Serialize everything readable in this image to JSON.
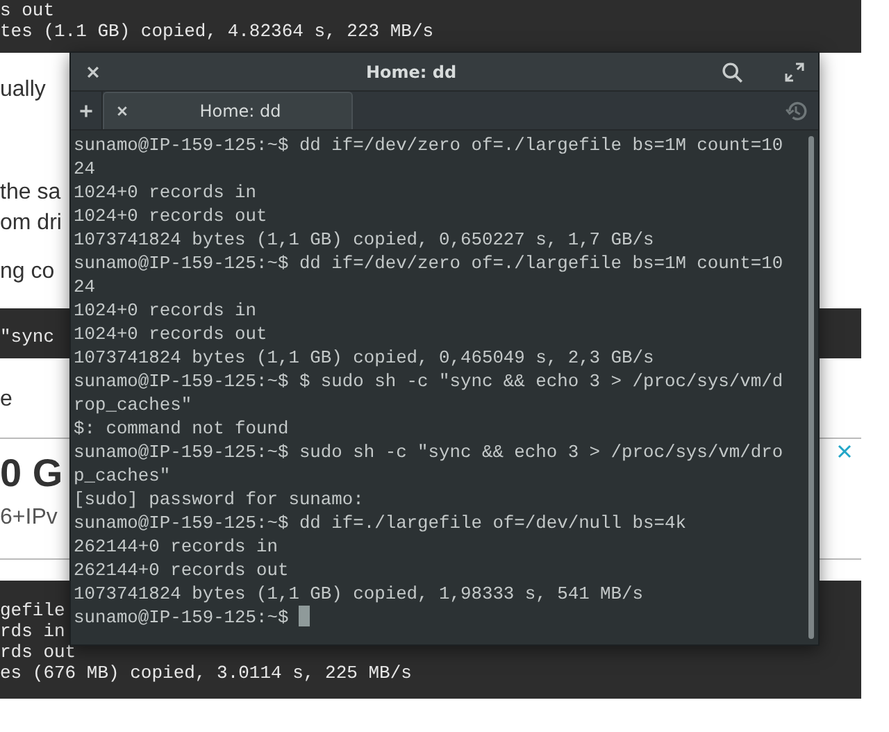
{
  "page": {
    "top_code": [
      "s out",
      "tes (1.1 GB) copied, 4.82364 s, 223 MB/s"
    ],
    "paragraph_fragments": [
      "ually",
      "the sa",
      "om dri",
      "ng co"
    ],
    "mid_code": [
      "\"sync"
    ],
    "fragment_after": "e",
    "ad": {
      "headline": "0 G",
      "subline": "6+IPv"
    },
    "bottom_code": [
      "gefile",
      "rds in",
      "rds out",
      "es (676 MB) copied, 3.0114 s, 225 MB/s"
    ]
  },
  "terminal": {
    "title": "Home: dd",
    "tabs": [
      {
        "label": "Home: dd",
        "selected": true
      }
    ],
    "lines": [
      "sunamo@IP-159-125:~$ dd if=/dev/zero of=./largefile bs=1M count=10",
      "24",
      "1024+0 records in",
      "1024+0 records out",
      "1073741824 bytes (1,1 GB) copied, 0,650227 s, 1,7 GB/s",
      "sunamo@IP-159-125:~$ dd if=/dev/zero of=./largefile bs=1M count=10",
      "24",
      "1024+0 records in",
      "1024+0 records out",
      "1073741824 bytes (1,1 GB) copied, 0,465049 s, 2,3 GB/s",
      "sunamo@IP-159-125:~$ $ sudo sh -c \"sync && echo 3 > /proc/sys/vm/d",
      "rop_caches\"",
      "$: command not found",
      "sunamo@IP-159-125:~$ sudo sh -c \"sync && echo 3 > /proc/sys/vm/dro",
      "p_caches\"",
      "[sudo] password for sunamo:",
      "sunamo@IP-159-125:~$ dd if=./largefile of=/dev/null bs=4k",
      "262144+0 records in",
      "262144+0 records out",
      "1073741824 bytes (1,1 GB) copied, 1,98333 s, 541 MB/s",
      "sunamo@IP-159-125:~$ "
    ]
  }
}
